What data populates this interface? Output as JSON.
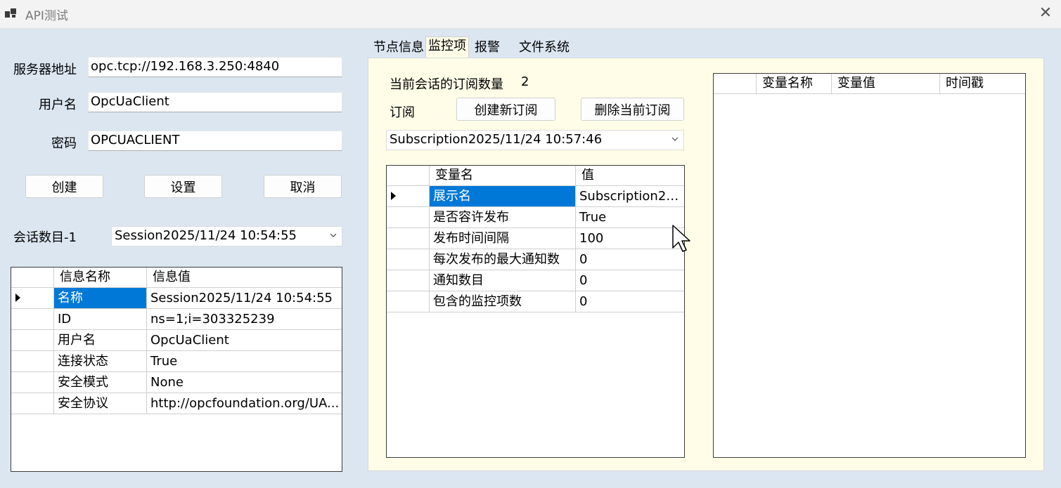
{
  "window": {
    "title": "API测试",
    "close_glyph": "✕"
  },
  "connection": {
    "server_label": "服务器地址",
    "server_value": "opc.tcp://192.168.3.250:4840",
    "user_label": "用户名",
    "user_value": "OpcUaClient",
    "password_label": "密码",
    "password_value": "OPCUACLIENT",
    "create_label": "创建",
    "settings_label": "设置",
    "cancel_label": "取消",
    "session_count_label": "会话数目-1",
    "session_selected": "Session2025/11/24 10:54:55"
  },
  "session_grid": {
    "col_name": "信息名称",
    "col_value": "信息值",
    "rows": [
      {
        "name": "名称",
        "value": "Session2025/11/24 10:54:55"
      },
      {
        "name": "ID",
        "value": "ns=1;i=303325239"
      },
      {
        "name": "用户名",
        "value": "OpcUaClient"
      },
      {
        "name": "连接状态",
        "value": "True"
      },
      {
        "name": "安全模式",
        "value": "None"
      },
      {
        "name": "安全协议",
        "value": "http://opcfoundation.org/UA..."
      }
    ]
  },
  "tabs": [
    {
      "label": "节点信息"
    },
    {
      "label": "监控项"
    },
    {
      "label": "报警"
    },
    {
      "label": "文件系统"
    }
  ],
  "subscription": {
    "count_label": "当前会话的订阅数量",
    "count_value": "2",
    "subscribe_label": "订阅",
    "create_button": "创建新订阅",
    "delete_button": "删除当前订阅",
    "selected": "Subscription2025/11/24 10:57:46"
  },
  "sub_grid": {
    "col_name": "变量名",
    "col_value": "值",
    "rows": [
      {
        "name": "展示名",
        "value": "Subscription20..."
      },
      {
        "name": "是否容许发布",
        "value": "True"
      },
      {
        "name": "发布时间间隔",
        "value": "100"
      },
      {
        "name": "每次发布的最大通知数",
        "value": "0"
      },
      {
        "name": "通知数目",
        "value": "0"
      },
      {
        "name": "包含的监控项数",
        "value": "0"
      }
    ]
  },
  "monitor_grid": {
    "col_name": "变量名称",
    "col_value": "变量值",
    "col_time": "时间戳"
  },
  "colors": {
    "background": "#dbe6f1",
    "panel": "#fffde8",
    "selection": "#0078d7"
  }
}
